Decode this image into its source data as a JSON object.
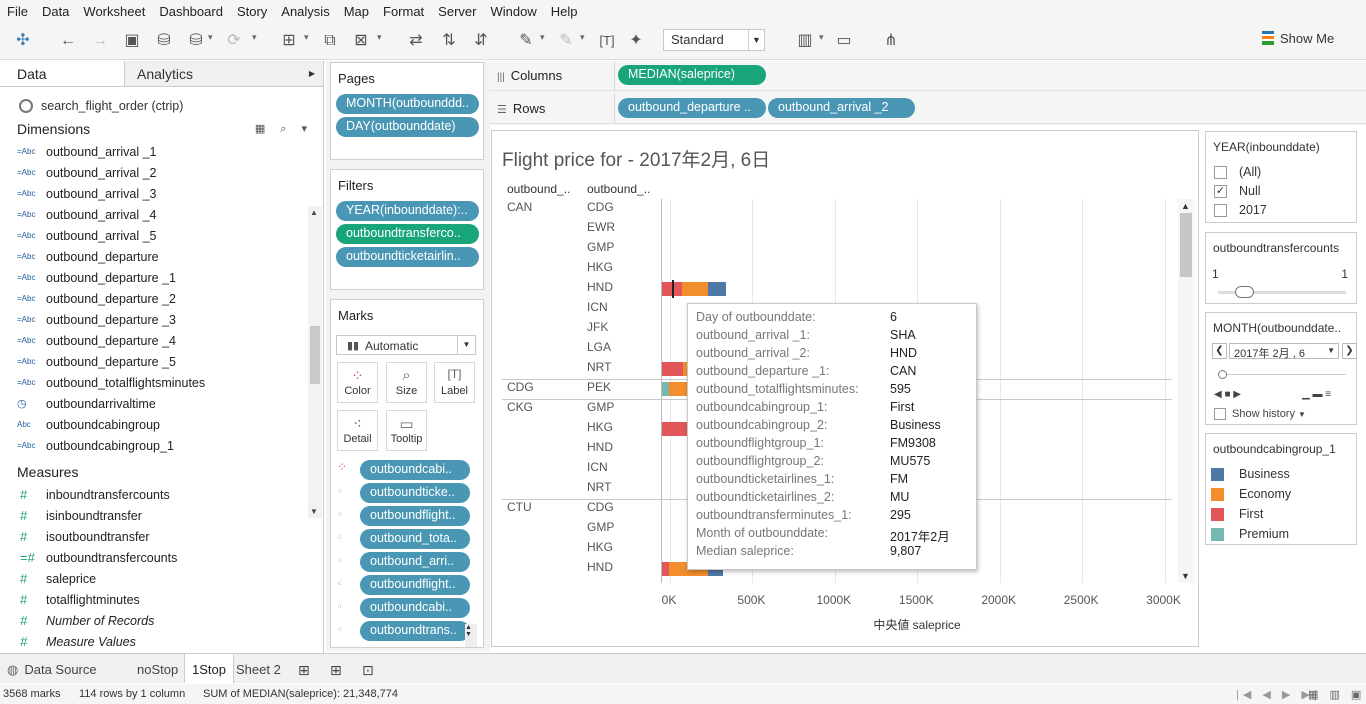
{
  "menu": [
    "File",
    "Data",
    "Worksheet",
    "Dashboard",
    "Story",
    "Analysis",
    "Map",
    "Format",
    "Server",
    "Window",
    "Help"
  ],
  "toolbar": {
    "standard_label": "Standard",
    "show_me_label": "Show Me"
  },
  "data_pane": {
    "tab_data": "Data",
    "tab_analytics": "Analytics",
    "datasource": "search_flight_order (ctrip)",
    "dimensions_label": "Dimensions",
    "dimensions": [
      {
        "type": "=Abc",
        "name": "outbound_arrival _1"
      },
      {
        "type": "=Abc",
        "name": "outbound_arrival _2"
      },
      {
        "type": "=Abc",
        "name": "outbound_arrival _3"
      },
      {
        "type": "=Abc",
        "name": "outbound_arrival _4"
      },
      {
        "type": "=Abc",
        "name": "outbound_arrival _5"
      },
      {
        "type": "=Abc",
        "name": "outbound_departure"
      },
      {
        "type": "=Abc",
        "name": "outbound_departure _1"
      },
      {
        "type": "=Abc",
        "name": "outbound_departure _2"
      },
      {
        "type": "=Abc",
        "name": "outbound_departure _3"
      },
      {
        "type": "=Abc",
        "name": "outbound_departure _4"
      },
      {
        "type": "=Abc",
        "name": "outbound_departure _5"
      },
      {
        "type": "=Abc",
        "name": "outbound_totalflightsminutes"
      },
      {
        "type": "date",
        "name": "outboundarrivaltime"
      },
      {
        "type": "Abc",
        "name": "outboundcabingroup"
      },
      {
        "type": "=Abc",
        "name": "outboundcabingroup_1"
      }
    ],
    "measures_label": "Measures",
    "measures": [
      {
        "name": "inboundtransfercounts"
      },
      {
        "name": "isinboundtransfer"
      },
      {
        "name": "isoutboundtransfer"
      },
      {
        "name": "outboundtransfercounts"
      },
      {
        "name": "saleprice"
      },
      {
        "name": "totalflightminutes"
      },
      {
        "name": "Number of Records"
      },
      {
        "name": "Measure Values"
      }
    ]
  },
  "pages": {
    "title": "Pages",
    "pills": [
      "MONTH(outbounddd..",
      "DAY(outbounddate)"
    ]
  },
  "filters": {
    "title": "Filters",
    "pills": [
      "YEAR(inbounddate):..",
      "outboundtransferco..",
      "outboundticketairlin.."
    ]
  },
  "marks": {
    "title": "Marks",
    "type": "Automatic",
    "buttons": [
      "Color",
      "Size",
      "Label",
      "Detail",
      "Tooltip"
    ],
    "pills": [
      "outboundcabi..",
      "outboundticke..",
      "outboundflight..",
      "outbound_tota..",
      "outbound_arri..",
      "outboundflight..",
      "outboundcabi..",
      "outboundtrans.."
    ]
  },
  "shelves": {
    "columns_label": "Columns",
    "columns_pill": "MEDIAN(saleprice)",
    "rows_label": "Rows",
    "rows_pills": [
      "outbound_departure ..",
      "outbound_arrival _2"
    ]
  },
  "view": {
    "title": "Flight price for - 2017年2月, 6日",
    "col_headers": [
      "outbound_..",
      "outbound_.."
    ],
    "groups": [
      {
        "dep": "CAN",
        "arrs": [
          "CDG",
          "EWR",
          "GMP",
          "HKG",
          "HND",
          "ICN",
          "JFK",
          "LGA",
          "NRT"
        ]
      },
      {
        "dep": "CDG",
        "arrs": [
          "PEK"
        ]
      },
      {
        "dep": "CKG",
        "arrs": [
          "GMP",
          "HKG",
          "HND",
          "ICN",
          "NRT"
        ]
      },
      {
        "dep": "CTU",
        "arrs": [
          "CDG",
          "GMP",
          "HKG",
          "HND"
        ]
      }
    ],
    "x_ticks": [
      "0K",
      "500K",
      "1000K",
      "1500K",
      "2000K",
      "2500K",
      "3000K"
    ],
    "x_title": "中央値 saleprice"
  },
  "chart_data": {
    "type": "bar",
    "orientation": "horizontal",
    "stacked": true,
    "xlabel": "中央値 saleprice",
    "xlim": [
      0,
      3100000
    ],
    "legend_series": [
      "Business",
      "Economy",
      "First",
      "Premium"
    ],
    "colors": {
      "Business": "#4e79a7",
      "Economy": "#f28e2b",
      "First": "#e15759",
      "Premium": "#76b7b2"
    },
    "rows": [
      {
        "category": "CAN / HND",
        "segments": [
          {
            "s": "First",
            "v": 120000
          },
          {
            "s": "Economy",
            "v": 160000
          },
          {
            "s": "Business",
            "v": 110000
          }
        ]
      },
      {
        "category": "CAN / NRT",
        "segments": [
          {
            "s": "First",
            "v": 130000
          },
          {
            "s": "Economy",
            "v": 60000
          }
        ]
      },
      {
        "category": "CDG / PEK",
        "segments": [
          {
            "s": "Premium",
            "v": 40000
          },
          {
            "s": "Economy",
            "v": 120000
          }
        ]
      },
      {
        "category": "CKG / HKG",
        "segments": [
          {
            "s": "First",
            "v": 150000
          },
          {
            "s": "Economy",
            "v": 40000
          }
        ]
      },
      {
        "category": "CTU / HND",
        "segments": [
          {
            "s": "First",
            "v": 40000
          },
          {
            "s": "Economy",
            "v": 240000
          },
          {
            "s": "Business",
            "v": 90000
          }
        ]
      }
    ]
  },
  "tooltip": [
    {
      "k": "Day of outbounddate:",
      "v": "6"
    },
    {
      "k": "outbound_arrival _1:",
      "v": "SHA"
    },
    {
      "k": "outbound_arrival _2:",
      "v": "HND"
    },
    {
      "k": "outbound_departure _1:",
      "v": "CAN"
    },
    {
      "k": "outbound_totalflightsminutes:",
      "v": "595"
    },
    {
      "k": "outboundcabingroup_1:",
      "v": "First"
    },
    {
      "k": "outboundcabingroup_2:",
      "v": "Business"
    },
    {
      "k": "outboundflightgroup_1:",
      "v": "FM9308"
    },
    {
      "k": "outboundflightgroup_2:",
      "v": "MU575"
    },
    {
      "k": "outboundticketairlines_1:",
      "v": "FM"
    },
    {
      "k": "outboundticketairlines_2:",
      "v": "MU"
    },
    {
      "k": "outboundtransferminutes_1:",
      "v": "295"
    },
    {
      "k": "Month of outbounddate:",
      "v": "2017年2月"
    },
    {
      "k": "Median saleprice:",
      "v": "9,807"
    }
  ],
  "year_filter": {
    "title": "YEAR(inbounddate)",
    "options": [
      {
        "label": "(All)",
        "checked": false
      },
      {
        "label": "Null",
        "checked": true
      },
      {
        "label": "2017",
        "checked": false
      }
    ]
  },
  "transfer_filter": {
    "title": "outboundtransfercounts",
    "min": "1",
    "max": "1"
  },
  "month_page": {
    "title": "MONTH(outbounddate..",
    "value": "2017年 2月 , 6",
    "show_history": "Show history"
  },
  "legend": {
    "title": "outboundcabingroup_1",
    "items": [
      "Business",
      "Economy",
      "First",
      "Premium"
    ]
  },
  "sheets": {
    "data_source": "Data Source",
    "tabs": [
      "noStop",
      "1Stop",
      "Sheet 2"
    ],
    "active": "1Stop"
  },
  "status": {
    "marks": "3568 marks",
    "rows": "114 rows by 1 column",
    "sum": "SUM of MEDIAN(saleprice): 21,348,774"
  }
}
